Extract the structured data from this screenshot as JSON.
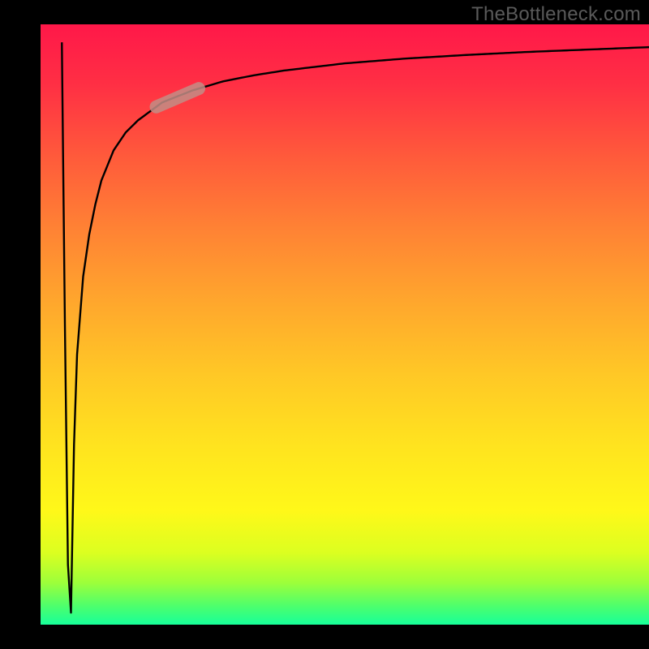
{
  "watermark": "TheBottleneck.com",
  "colors": {
    "gradient_top": "#ff1849",
    "gradient_mid": "#ffe31f",
    "gradient_bottom": "#17ff9a",
    "curve": "#000000",
    "highlight": "#c38e86",
    "background": "#000000",
    "watermark_text": "#5a5a5a"
  },
  "chart_data": {
    "type": "line",
    "title": "",
    "xlabel": "",
    "ylabel": "",
    "xlim": [
      0,
      100
    ],
    "ylim": [
      0,
      100
    ],
    "grid": false,
    "legend": false,
    "annotations": [
      {
        "type": "highlight_segment",
        "x_range": [
          19,
          26
        ],
        "style": "pill",
        "color": "#c38e86"
      }
    ],
    "series": [
      {
        "name": "spike",
        "x": [
          3.5,
          4.0,
          4.5,
          5.0
        ],
        "y": [
          97,
          50,
          10,
          2
        ]
      },
      {
        "name": "curve",
        "x": [
          5.0,
          5.5,
          6.0,
          7.0,
          8.0,
          9.0,
          10.0,
          12.0,
          14.0,
          16.0,
          18.0,
          20.0,
          22.5,
          25.0,
          30.0,
          35.0,
          40.0,
          50.0,
          60.0,
          70.0,
          80.0,
          90.0,
          100.0
        ],
        "y": [
          2,
          30,
          45,
          58,
          65,
          70,
          74,
          79,
          82,
          84,
          85.5,
          87,
          88,
          89,
          90.5,
          91.5,
          92.3,
          93.5,
          94.3,
          94.9,
          95.4,
          95.8,
          96.2
        ]
      }
    ]
  }
}
